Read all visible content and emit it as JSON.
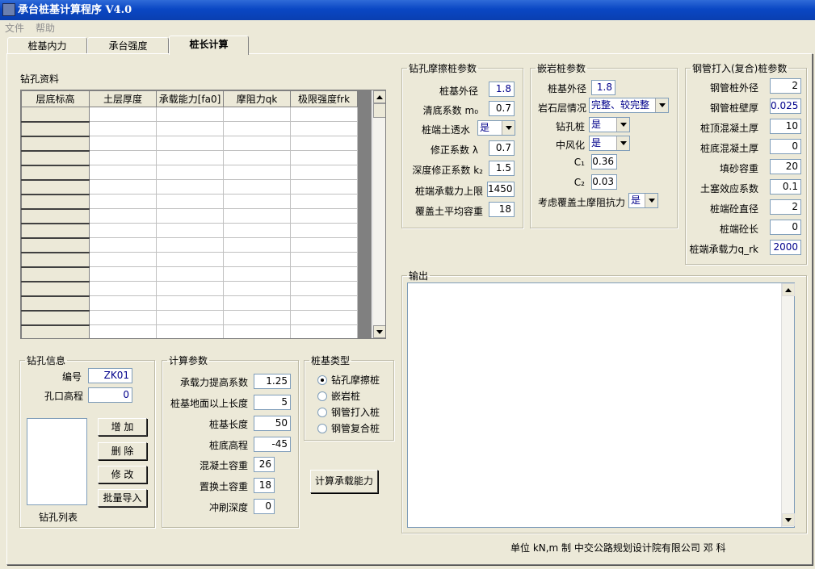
{
  "window": {
    "title": "承台桩基计算程序 V4.0"
  },
  "menu": {
    "file": "文件",
    "help": "帮助"
  },
  "tabs": {
    "t1": "桩基内力",
    "t2": "承台强度",
    "t3": "桩长计算"
  },
  "borehole_data": {
    "title": "钻孔资料",
    "columns": [
      "层底标高",
      "土层厚度",
      "承载能力[fa0]",
      "摩阻力qk",
      "极限强度frk"
    ],
    "row_count": 16
  },
  "borehole_info": {
    "title": "钻孔信息",
    "id_label": "编号",
    "id_value": "ZK01",
    "elev_label": "孔口高程",
    "elev_value": "0",
    "list_label": "钻孔列表",
    "add": "增 加",
    "delete": "删 除",
    "modify": "修 改",
    "batch_import": "批量导入"
  },
  "calc_params": {
    "title": "计算参数",
    "fields": [
      {
        "label": "承载力提高系数",
        "value": "1.25"
      },
      {
        "label": "桩基地面以上长度",
        "value": "5"
      },
      {
        "label": "桩基长度",
        "value": "50"
      },
      {
        "label": "桩底高程",
        "value": "-45"
      },
      {
        "label": "混凝土容重",
        "value": "26"
      },
      {
        "label": "置换土容重",
        "value": "18"
      },
      {
        "label": "冲刷深度",
        "value": "0"
      }
    ]
  },
  "pile_type": {
    "title": "桩基类型",
    "options": [
      "钻孔摩擦桩",
      "嵌岩桩",
      "钢管打入桩",
      "钢管复合桩"
    ],
    "selected": "钻孔摩擦桩"
  },
  "calc_button": "计算承载能力",
  "friction_pile": {
    "title": "钻孔摩擦桩参数",
    "diameter_label": "桩基外径",
    "diameter": "1.8",
    "m0_label": "清底系数",
    "m0_sym": "m₀",
    "m0": "0.7",
    "permeable_label": "桩端土透水",
    "permeable": "是",
    "lambda_label": "修正系数",
    "lambda_sym": "λ",
    "lambda": "0.7",
    "k2_label": "深度修正系数",
    "k2_sym": "k₂",
    "k2": "1.5",
    "limit_label": "桩端承载力上限",
    "limit": "1450",
    "gamma_label": "覆盖土平均容重",
    "gamma": "18"
  },
  "rock_pile": {
    "title": "嵌岩桩参数",
    "diameter_label": "桩基外径",
    "diameter": "1.8",
    "rock_label": "岩石层情况",
    "rock": "完整、较完整",
    "bored_label": "钻孔桩",
    "bored": "是",
    "weathered_label": "中风化",
    "weathered": "是",
    "c1_label": "C₁",
    "c1": "0.36",
    "c2_label": "C₂",
    "c2": "0.03",
    "consider_label": "考虑覆盖土摩阻抗力",
    "consider": "是"
  },
  "steel_pile": {
    "title": "钢管打入(复合)桩参数",
    "fields": [
      {
        "label": "钢管桩外径",
        "value": "2"
      },
      {
        "label": "钢管桩壁厚",
        "value": "0.025"
      },
      {
        "label": "桩顶混凝土厚",
        "value": "10"
      },
      {
        "label": "桩底混凝土厚",
        "value": "0"
      },
      {
        "label": "填砂容重",
        "value": "20"
      },
      {
        "label": "土塞效应系数",
        "value": "0.1"
      },
      {
        "label": "桩端砼直径",
        "value": "2"
      },
      {
        "label": "桩端砼长",
        "value": "0"
      },
      {
        "label": "桩端承载力q_rk",
        "value": "2000"
      }
    ]
  },
  "output": {
    "title": "输出",
    "text": ""
  },
  "footer": "单位 kN,m 制 中交公路规划设计院有限公司 邓 科"
}
